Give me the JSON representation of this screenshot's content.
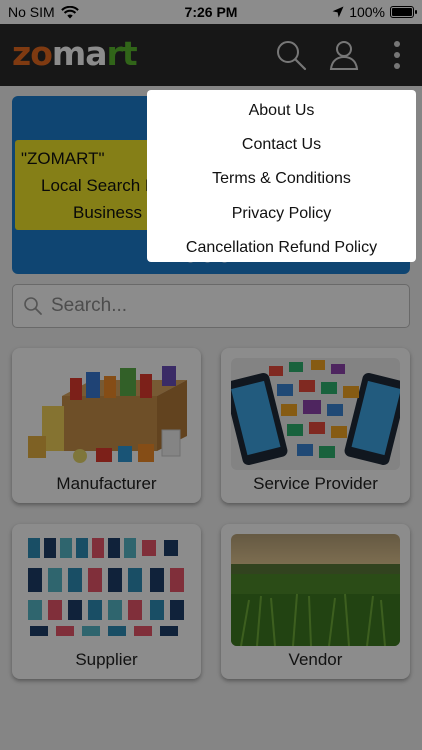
{
  "status_bar": {
    "carrier": "No SIM",
    "time": "7:26 PM",
    "battery_text": "100%",
    "battery_level": 1.0
  },
  "header": {
    "logo": {
      "part1": "zo",
      "part2": "ma",
      "part3": "rt"
    },
    "icons": [
      "search-icon",
      "user-icon",
      "more-vertical-icon"
    ]
  },
  "banner": {
    "line1": "\"ZOMART\"",
    "line2": "Local Search Er",
    "line3": "Business D",
    "slide_count": 3,
    "color": "#1d7fd0",
    "card_color": "#f3e82a"
  },
  "search": {
    "placeholder": "Search..."
  },
  "categories": [
    {
      "label": "Manufacturer"
    },
    {
      "label": "Service Provider"
    },
    {
      "label": "Supplier"
    },
    {
      "label": "Vendor"
    }
  ],
  "menu": {
    "items": [
      {
        "label": "About Us"
      },
      {
        "label": "Contact Us"
      },
      {
        "label": "Terms & Conditions"
      },
      {
        "label": "Privacy Policy"
      },
      {
        "label": "Cancellation Refund Policy"
      }
    ]
  },
  "colors": {
    "header_bg": "#2b2b2b",
    "logo_orange": "#e86a1f",
    "logo_green": "#59b92f"
  }
}
